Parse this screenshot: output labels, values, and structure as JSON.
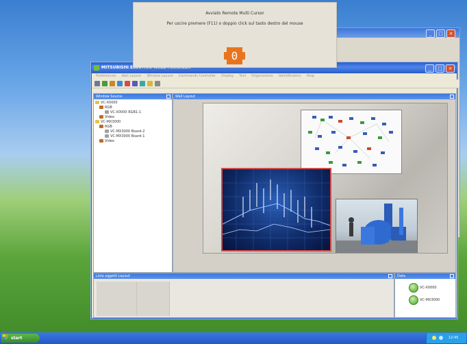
{
  "notification": {
    "title": "Avviato Remote Multi Cursor",
    "message": "Per uscire premere (F11) o doppio click sul tasto destro del mouse",
    "counter": "0"
  },
  "app": {
    "title": "MITSUBISHI ELECTRIC WALL MANAGER",
    "menu": [
      "Preferences",
      "Wall Layout",
      "Window Layout",
      "Commands Controller",
      "Display",
      "Tool",
      "Organization",
      "Identification",
      "Help"
    ]
  },
  "window_source": {
    "title": "Window Source",
    "tree": [
      {
        "label": "VC-X0000",
        "level": 0,
        "type": "folder"
      },
      {
        "label": "RGB",
        "level": 1,
        "type": "node"
      },
      {
        "label": "VC-X0000 RGB1-1",
        "level": 2,
        "type": "leaf"
      },
      {
        "label": "Video",
        "level": 1,
        "type": "node"
      },
      {
        "label": "VC-MX3000",
        "level": 0,
        "type": "folder"
      },
      {
        "label": "RGB",
        "level": 1,
        "type": "node"
      },
      {
        "label": "VC-MX3000 Board-2",
        "level": 2,
        "type": "leaf"
      },
      {
        "label": "VC-MX3000 Board-1",
        "level": 2,
        "type": "leaf"
      },
      {
        "label": "Video",
        "level": 1,
        "type": "node"
      }
    ]
  },
  "wall_layout": {
    "title": "Wall Layout"
  },
  "list_panel": {
    "title": "Lista oggetti Layout"
  },
  "data_panel": {
    "title": "Data",
    "items": [
      "VC-X0000",
      "VC-MX3000"
    ]
  },
  "taskbar": {
    "start_label": "start",
    "clock": "12:45"
  },
  "colors": {
    "accent": "#3b78dc",
    "counter": "#e8751e",
    "chart_border": "#d04a4a"
  }
}
